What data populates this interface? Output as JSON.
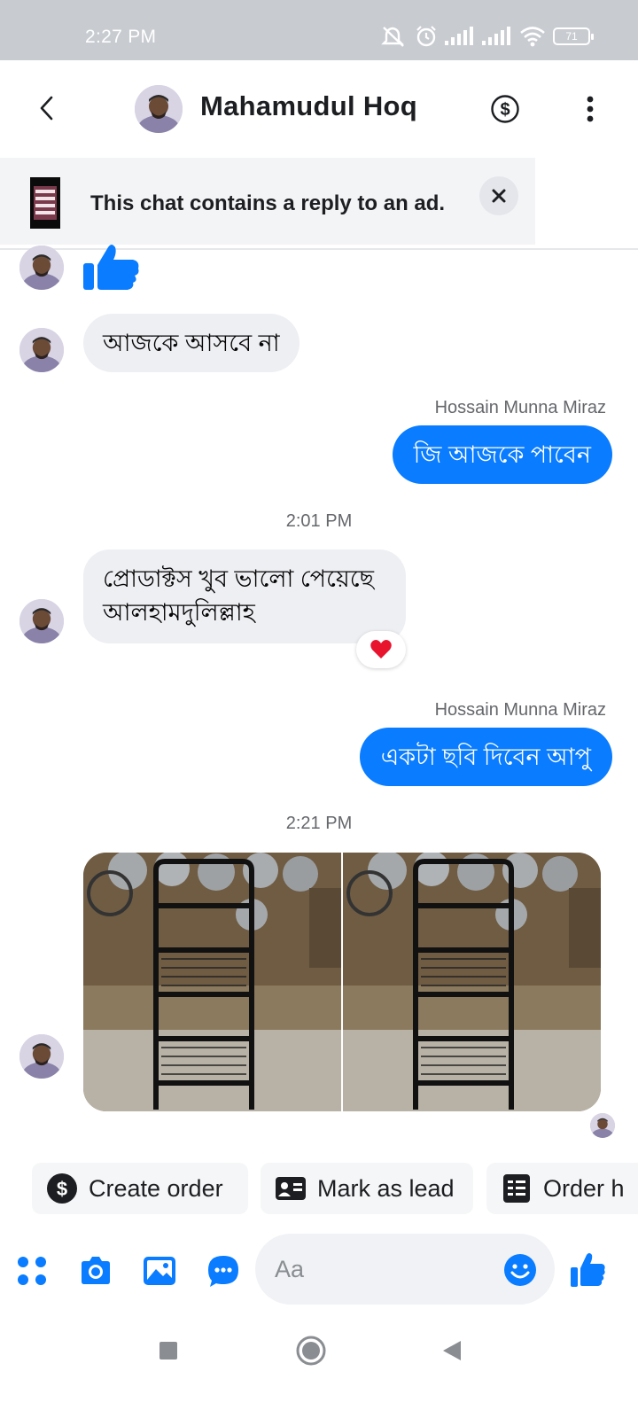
{
  "status_bar": {
    "time": "2:27 PM",
    "battery": "71"
  },
  "header": {
    "contact_name": "Mahamudul Hoq"
  },
  "ad_banner": {
    "text": "This chat contains a reply to an ad."
  },
  "messages": {
    "m2_text": "আজকে আসবে না",
    "sender_1": "Hossain Munna Miraz",
    "m3_text": "জি আজকে পাবেন",
    "time_1": "2:01 PM",
    "m4_line1": "প্রোডাক্টস খুব ভালো পেয়েছে",
    "m4_line2": "আলহামদুলিল্লাহ",
    "sender_2": "Hossain Munna Miraz",
    "m5_text": "একটা ছবি দিবেন আপু",
    "time_2": "2:21 PM"
  },
  "quick_actions": {
    "create_order": "Create order",
    "mark_as_lead": "Mark as lead",
    "order_history": "Order h"
  },
  "composer": {
    "placeholder": "Aa"
  },
  "colors": {
    "accent": "#0a7cff",
    "incoming_bubble": "#eeeff3",
    "status_bar": "#c8cbd0"
  },
  "icons": {
    "back": "chevron-left-icon",
    "payment": "dollar-circle-icon",
    "menu": "more-vertical-icon",
    "like": "thumbs-up-icon",
    "reaction": "heart-icon",
    "apps": "apps-icon",
    "camera": "camera-icon",
    "gallery": "image-icon",
    "chat": "chat-bubble-icon",
    "emoji": "smiley-icon"
  }
}
